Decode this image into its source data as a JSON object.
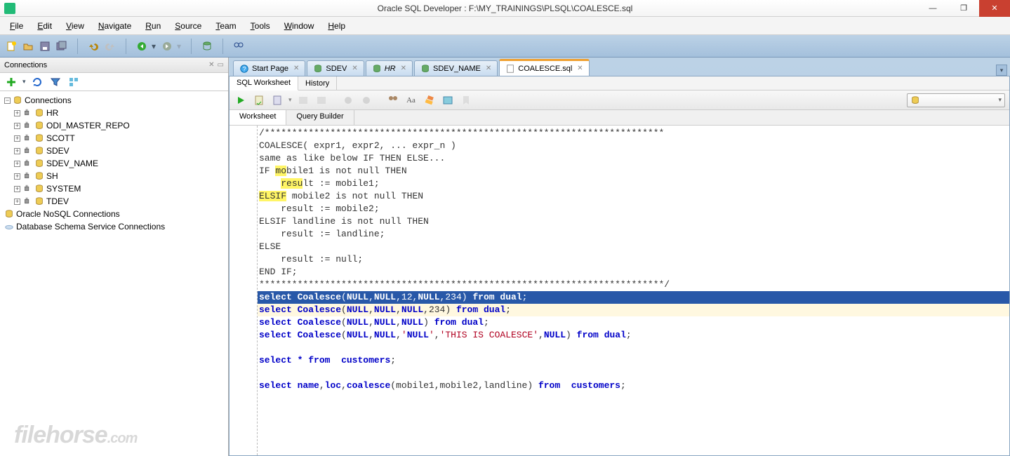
{
  "title": "Oracle SQL Developer : F:\\MY_TRAININGS\\PLSQL\\COALESCE.sql",
  "menu": [
    "File",
    "Edit",
    "View",
    "Navigate",
    "Run",
    "Source",
    "Team",
    "Tools",
    "Window",
    "Help"
  ],
  "connections_panel_title": "Connections",
  "tree_root": "Connections",
  "tree_items": [
    "HR",
    "ODI_MASTER_REPO",
    "SCOTT",
    "SDEV",
    "SDEV_NAME",
    "SH",
    "SYSTEM",
    "TDEV"
  ],
  "tree_extra": [
    "Oracle NoSQL Connections",
    "Database Schema Service Connections"
  ],
  "tabs": [
    {
      "label": "Start Page",
      "icon": "help"
    },
    {
      "label": "SDEV",
      "icon": "db"
    },
    {
      "label": "HR",
      "icon": "db",
      "italic": true
    },
    {
      "label": "SDEV_NAME",
      "icon": "db"
    },
    {
      "label": "COALESCE.sql",
      "icon": "sql",
      "active": true
    }
  ],
  "subtabs": [
    "SQL Worksheet",
    "History"
  ],
  "ws_tabs": [
    "Worksheet",
    "Query Builder"
  ],
  "code": [
    {
      "t": "/*************************************************************************",
      "cls": "c"
    },
    {
      "t": "COALESCE( expr1, expr2, ... expr_n )"
    },
    {
      "t": "same as like below IF THEN ELSE..."
    },
    {
      "t": "IF mobile1 is not null THEN",
      "hl": "y1"
    },
    {
      "t": "    result := mobile1;",
      "hl": "y2"
    },
    {
      "t": "ELSIF mobile2 is not null THEN",
      "hl": "y3"
    },
    {
      "t": "    result := mobile2;"
    },
    {
      "t": "ELSIF landline is not null THEN"
    },
    {
      "t": "    result := landline;"
    },
    {
      "t": "ELSE"
    },
    {
      "t": "    result := null;"
    },
    {
      "t": "END IF;"
    },
    {
      "t": "**************************************************************************/",
      "cls": "c"
    },
    {
      "sql": "select Coalesce(NULL,NULL,12,NULL,234) from dual;",
      "sel": true
    },
    {
      "sql": "select Coalesce(NULL,NULL,NULL,234) from dual;",
      "cur": true
    },
    {
      "sql": "select Coalesce(NULL,NULL,NULL) from dual;"
    },
    {
      "sql": "select Coalesce(NULL,NULL,'NULL','THIS IS COALESCE',NULL) from dual;"
    },
    {
      "t": ""
    },
    {
      "sql": "select * from  customers;"
    },
    {
      "t": ""
    },
    {
      "sql": "select name,loc,coalesce(mobile1,mobile2,landline) from  customers;"
    }
  ],
  "watermark": "filehorse",
  "watermark_suffix": ".com"
}
